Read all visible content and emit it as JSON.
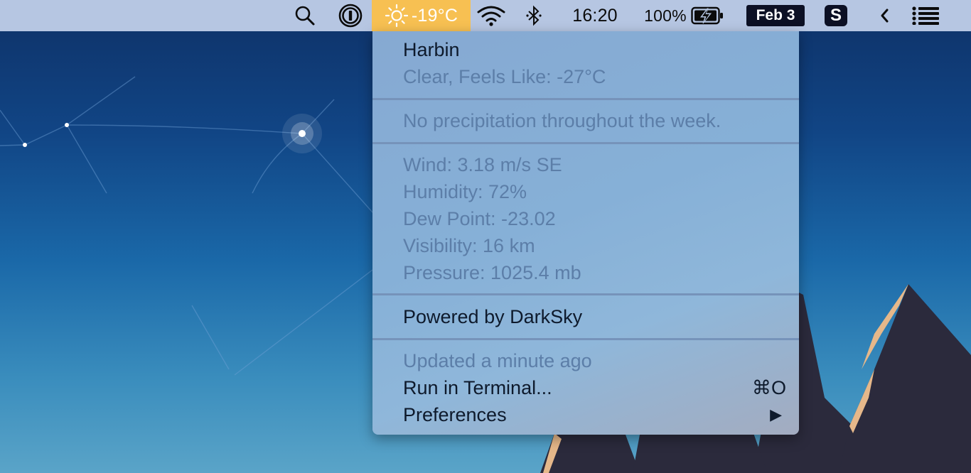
{
  "menubar": {
    "weather_temp": "-19°C",
    "time": "16:20",
    "battery_percent": "100%",
    "date": "Feb 3",
    "s_app_label": "S",
    "icons": [
      "search-icon",
      "1password-icon",
      "sun-icon",
      "wifi-icon",
      "bluetooth-icon",
      "battery-charging-icon",
      "chevron-left-icon",
      "list-icon"
    ]
  },
  "menu": {
    "location": "Harbin",
    "condition": "Clear, Feels Like: -27°C",
    "precipitation": "No precipitation throughout the week.",
    "wind": "Wind: 3.18 m/s SE",
    "humidity": "Humidity: 72%",
    "dew_point": "Dew Point: -23.02",
    "visibility": "Visibility: 16 km",
    "pressure": "Pressure: 1025.4 mb",
    "powered_by": "Powered by DarkSky",
    "updated": "Updated a minute ago",
    "run_in_terminal": "Run in Terminal...",
    "run_shortcut": "⌘O",
    "preferences": "Preferences",
    "submenu_arrow": "▶"
  },
  "colors": {
    "menubar_bg": "#b6c6e2",
    "weather_highlight": "#f7c052",
    "menu_text_strong": "#0e1a2c",
    "menu_text_dim": "#5c7ea8"
  }
}
